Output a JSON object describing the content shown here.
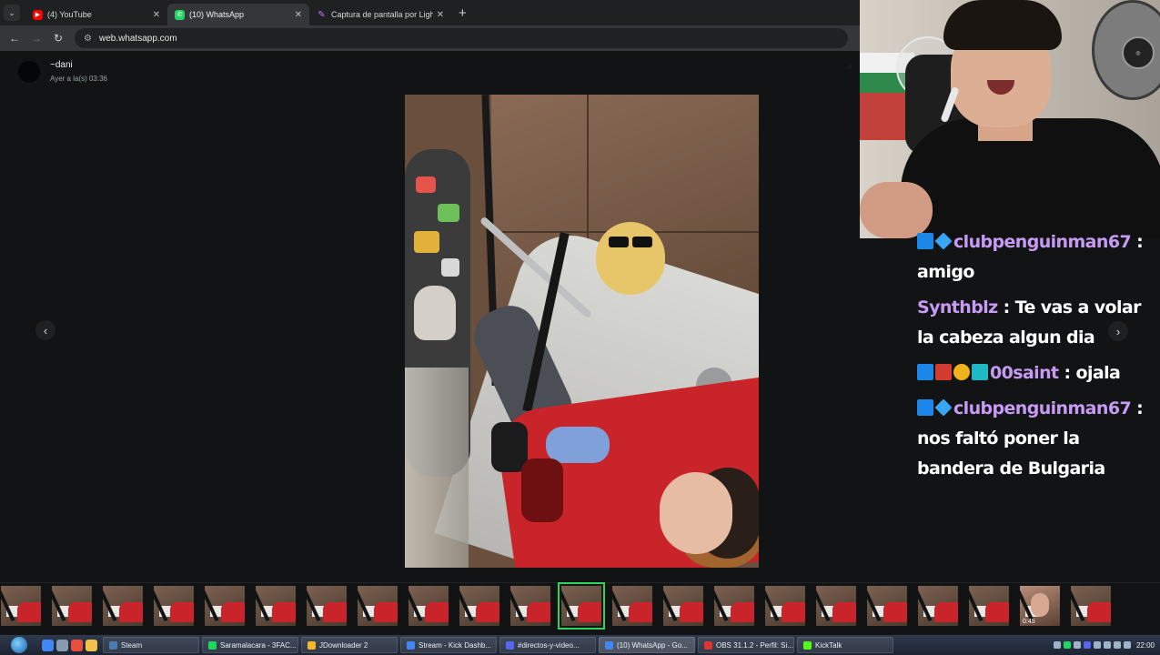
{
  "browser": {
    "tabs": [
      {
        "title": "(4) YouTube",
        "icon": "youtube-icon",
        "active": false
      },
      {
        "title": "(10) WhatsApp",
        "icon": "whatsapp-icon",
        "active": true
      },
      {
        "title": "Captura de pantalla por Lightsh",
        "icon": "lightshot-feather-icon",
        "active": false
      }
    ],
    "close_glyph": "✕",
    "new_tab_glyph": "+",
    "url": "web.whatsapp.com"
  },
  "viewer": {
    "sender_name": "~dani",
    "timestamp": "Ayer a la(s) 03:36",
    "prev_glyph": "‹",
    "next_glyph": "›",
    "thumb_count": 22,
    "selected_thumb_index": 11,
    "video_thumb_index": 20,
    "video_duration": "0:45"
  },
  "chat": {
    "messages": [
      {
        "badges": [
          "b-blue",
          "b-cube"
        ],
        "user": "clubpenguinman67",
        "sep": " :",
        "text": "amigo"
      },
      {
        "badges": [],
        "user": "Synthblz",
        "sep": " :",
        "text": "Te vas a volar la cabeza algun dia"
      },
      {
        "badges": [
          "b-blue",
          "b-red",
          "b-gold",
          "b-teal"
        ],
        "user": "00saint",
        "sep": " :",
        "text": "ojala"
      },
      {
        "badges": [
          "b-blue",
          "b-cube"
        ],
        "user": "clubpenguinman67",
        "sep": " :",
        "text": "nos faltó poner la bandera de Bulgaria"
      }
    ]
  },
  "taskbar": {
    "buttons": [
      {
        "label": "Steam",
        "color": "#4b7bb5"
      },
      {
        "label": "Saramalacara - 3FAC...",
        "color": "#1ed760"
      },
      {
        "label": "JDownloader 2",
        "color": "#f5b62a"
      },
      {
        "label": "Stream - Kick Dashb...",
        "color": "#4285f4"
      },
      {
        "label": "#directos-y-video...",
        "color": "#5865f2"
      },
      {
        "label": "(10) WhatsApp - Go...",
        "color": "#4285f4"
      },
      {
        "label": "OBS 31.1.2 - Perfil: Si...",
        "color": "#d33"
      },
      {
        "label": "KickTalk",
        "color": "#53fc18"
      }
    ],
    "clock": "22:00"
  }
}
